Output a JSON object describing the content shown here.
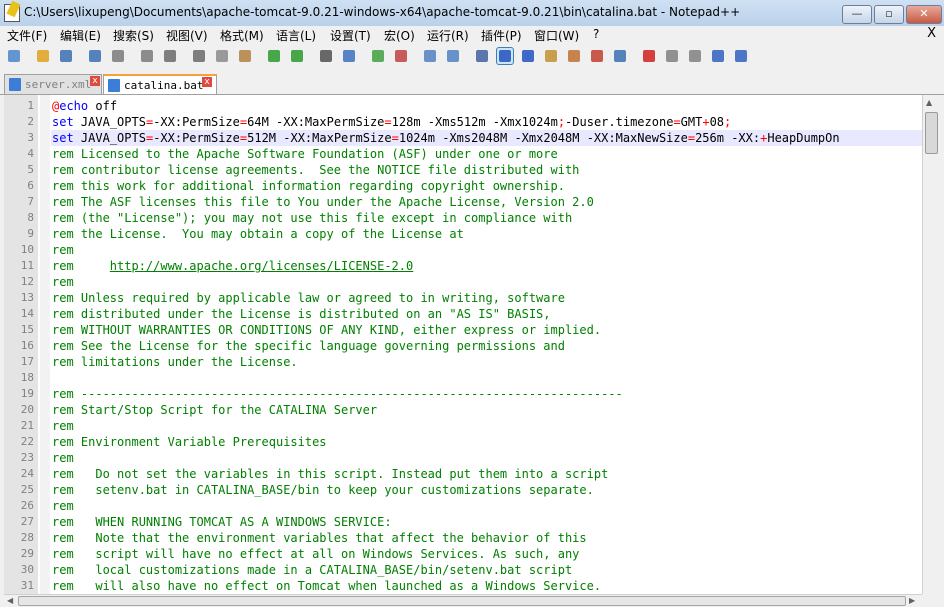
{
  "window": {
    "title": "C:\\Users\\lixupeng\\Documents\\apache-tomcat-9.0.21-windows-x64\\apache-tomcat-9.0.21\\bin\\catalina.bat - Notepad++",
    "minimize": "—",
    "maximize": "▫",
    "close": "✕"
  },
  "menu": {
    "items": [
      "文件(F)",
      "编辑(E)",
      "搜索(S)",
      "视图(V)",
      "格式(M)",
      "语言(L)",
      "设置(T)",
      "宏(O)",
      "运行(R)",
      "插件(P)",
      "窗口(W)",
      "?"
    ],
    "close_doc": "X"
  },
  "tabs": [
    {
      "label": "server.xml",
      "close": "x",
      "active": false
    },
    {
      "label": "catalina.bat",
      "close": "x",
      "active": true
    }
  ],
  "editor": {
    "lines": [
      {
        "n": "1",
        "text": "@echo off"
      },
      {
        "n": "2",
        "text": "set JAVA_OPTS=-XX:PermSize=64M -XX:MaxPermSize=128m -Xms512m -Xmx1024m;-Duser.timezone=GMT+08;"
      },
      {
        "n": "3",
        "text": "set JAVA_OPTS=-XX:PermSize=512M -XX:MaxPermSize=1024m -Xms2048M -Xmx2048M -XX:MaxNewSize=256m -XX:+HeapDumpOn"
      },
      {
        "n": "4",
        "text": "rem Licensed to the Apache Software Foundation (ASF) under one or more"
      },
      {
        "n": "5",
        "text": "rem contributor license agreements.  See the NOTICE file distributed with"
      },
      {
        "n": "6",
        "text": "rem this work for additional information regarding copyright ownership."
      },
      {
        "n": "7",
        "text": "rem The ASF licenses this file to You under the Apache License, Version 2.0"
      },
      {
        "n": "8",
        "text": "rem (the \"License\"); you may not use this file except in compliance with"
      },
      {
        "n": "9",
        "text": "rem the License.  You may obtain a copy of the License at"
      },
      {
        "n": "10",
        "text": "rem"
      },
      {
        "n": "11",
        "text": "rem     http://www.apache.org/licenses/LICENSE-2.0"
      },
      {
        "n": "12",
        "text": "rem"
      },
      {
        "n": "13",
        "text": "rem Unless required by applicable law or agreed to in writing, software"
      },
      {
        "n": "14",
        "text": "rem distributed under the License is distributed on an \"AS IS\" BASIS,"
      },
      {
        "n": "15",
        "text": "rem WITHOUT WARRANTIES OR CONDITIONS OF ANY KIND, either express or implied."
      },
      {
        "n": "16",
        "text": "rem See the License for the specific language governing permissions and"
      },
      {
        "n": "17",
        "text": "rem limitations under the License."
      },
      {
        "n": "18",
        "text": ""
      },
      {
        "n": "19",
        "text": "rem ---------------------------------------------------------------------------"
      },
      {
        "n": "20",
        "text": "rem Start/Stop Script for the CATALINA Server"
      },
      {
        "n": "21",
        "text": "rem"
      },
      {
        "n": "22",
        "text": "rem Environment Variable Prerequisites"
      },
      {
        "n": "23",
        "text": "rem"
      },
      {
        "n": "24",
        "text": "rem   Do not set the variables in this script. Instead put them into a script"
      },
      {
        "n": "25",
        "text": "rem   setenv.bat in CATALINA_BASE/bin to keep your customizations separate."
      },
      {
        "n": "26",
        "text": "rem"
      },
      {
        "n": "27",
        "text": "rem   WHEN RUNNING TOMCAT AS A WINDOWS SERVICE:"
      },
      {
        "n": "28",
        "text": "rem   Note that the environment variables that affect the behavior of this"
      },
      {
        "n": "29",
        "text": "rem   script will have no effect at all on Windows Services. As such, any"
      },
      {
        "n": "30",
        "text": "rem   local customizations made in a CATALINA_BASE/bin/setenv.bat script"
      },
      {
        "n": "31",
        "text": "rem   will also have no effect on Tomcat when launched as a Windows Service."
      }
    ]
  },
  "toolbar": {
    "icons": [
      "new-file-icon",
      "open-file-icon",
      "save-icon",
      "save-all-icon",
      "close-icon",
      "close-all-icon",
      "print-icon",
      "cut-icon",
      "copy-icon",
      "paste-icon",
      "undo-icon",
      "redo-icon",
      "find-icon",
      "replace-icon",
      "zoom-in-icon",
      "zoom-out-icon",
      "sync-v-icon",
      "sync-h-icon",
      "wrap-icon",
      "show-all-chars-icon",
      "indent-guide-icon",
      "doc-map-icon",
      "function-list-icon",
      "folder-workspace-icon",
      "monitor-icon",
      "record-macro-icon",
      "stop-record-icon",
      "play-macro-icon",
      "play-multiple-icon",
      "save-macro-icon"
    ]
  },
  "colors": {
    "comment": "#008000",
    "keyword": "#0000ff",
    "operator": "#ff0000",
    "current_line": "#e8e8ff",
    "gutter": "#e4e4e4"
  }
}
